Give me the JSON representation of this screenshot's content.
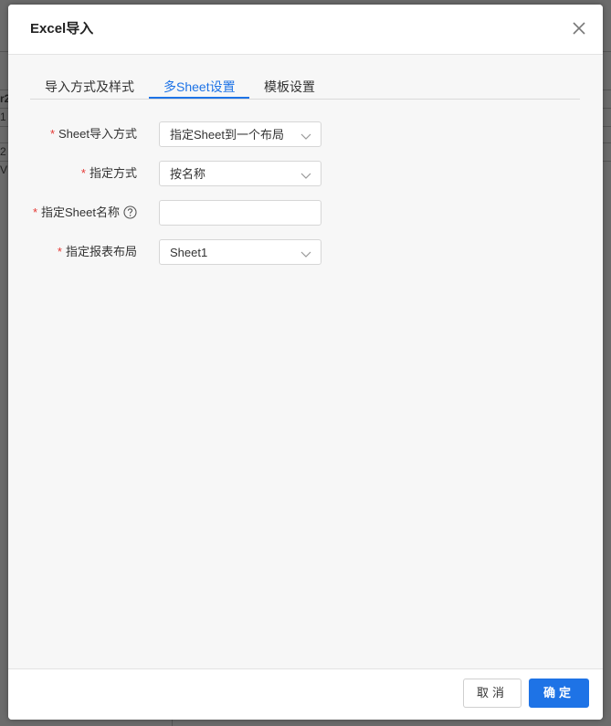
{
  "dialog": {
    "title": "Excel导入",
    "close_icon": "close-icon"
  },
  "tabs": [
    {
      "label": "导入方式及样式",
      "active": false
    },
    {
      "label": "多Sheet设置",
      "active": true
    },
    {
      "label": "模板设置",
      "active": false
    }
  ],
  "form": {
    "sheet_import_mode": {
      "label": "Sheet导入方式",
      "required": "*",
      "value": "指定Sheet到一个布局"
    },
    "specify_mode": {
      "label": "指定方式",
      "required": "*",
      "value": "按名称"
    },
    "sheet_name": {
      "label": "指定Sheet名称",
      "required": "*",
      "value": "",
      "help_icon": "question-circle-icon"
    },
    "report_layout": {
      "label": "指定报表布局",
      "required": "*",
      "value": "Sheet1"
    }
  },
  "footer": {
    "cancel_label": "取消",
    "ok_label": "确定"
  },
  "background": {
    "fragments": [
      "r2",
      "1",
      "2",
      "V"
    ]
  },
  "colors": {
    "accent": "#1e73e6",
    "required": "#e53935"
  }
}
